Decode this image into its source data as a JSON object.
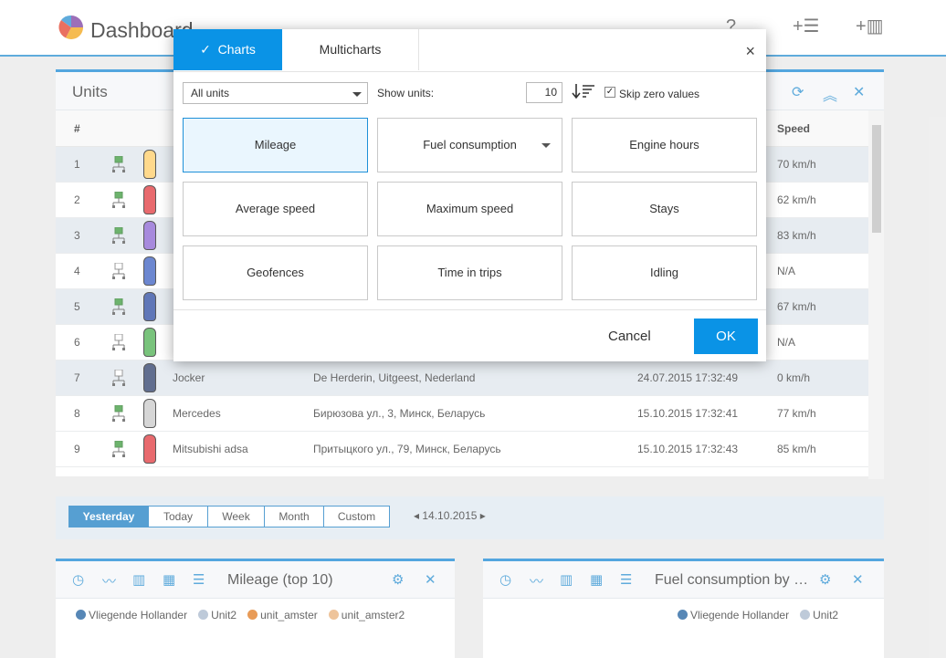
{
  "app": {
    "title": "Dashboard"
  },
  "units": {
    "title": "Units",
    "columns": {
      "num": "#",
      "speed": "Speed"
    },
    "rows": [
      {
        "num": "1",
        "name": "",
        "address": "",
        "time": "",
        "speed": "70 km/h",
        "online": true,
        "alt": true,
        "color": "#ffcc66"
      },
      {
        "num": "2",
        "name": "",
        "address": "",
        "time": "",
        "speed": "62 km/h",
        "online": true,
        "alt": false,
        "color": "#e0393e"
      },
      {
        "num": "3",
        "name": "",
        "address": "",
        "time": "",
        "speed": "83 km/h",
        "online": true,
        "alt": true,
        "color": "#8a63d2"
      },
      {
        "num": "4",
        "name": "",
        "address": "",
        "time": "",
        "speed": "N/A",
        "online": false,
        "alt": false,
        "color": "#3b5fc0"
      },
      {
        "num": "5",
        "name": "",
        "address": "",
        "time": "",
        "speed": "67 km/h",
        "online": true,
        "alt": true,
        "color": "#2b4aa0"
      },
      {
        "num": "6",
        "name": "",
        "address": "",
        "time": "",
        "speed": "N/A",
        "online": false,
        "alt": false,
        "color": "#4caf50"
      },
      {
        "num": "7",
        "name": "Jocker",
        "address": "De Herderin, Uitgeest, Nederland",
        "time": "24.07.2015 17:32:49",
        "speed": "0 km/h",
        "online": false,
        "alt": true,
        "color": "#2c3e6a"
      },
      {
        "num": "8",
        "name": "Mercedes",
        "address": "Бирюзова ул., 3, Минск, Беларусь",
        "time": "15.10.2015 17:32:41",
        "speed": "77 km/h",
        "online": true,
        "alt": false,
        "color": "#c8c8c8"
      },
      {
        "num": "9",
        "name": "Mitsubishi adsa",
        "address": "Притыцкого ул., 79, Минск, Беларусь",
        "time": "15.10.2015 17:32:43",
        "speed": "85 km/h",
        "online": true,
        "alt": false,
        "color": "#e0393e"
      }
    ]
  },
  "period": {
    "buttons": [
      "Yesterday",
      "Today",
      "Week",
      "Month",
      "Custom"
    ],
    "active": "Yesterday",
    "date": "14.10.2015"
  },
  "charts": {
    "left": {
      "title": "Mileage (top 10)",
      "legend": [
        {
          "name": "Vliegende Hollander",
          "color": "#1f5f9e"
        },
        {
          "name": "Unit2",
          "color": "#a9b8cc"
        },
        {
          "name": "unit_amster",
          "color": "#e07a1f"
        },
        {
          "name": "unit_amster2",
          "color": "#e8b07a"
        }
      ]
    },
    "right": {
      "title": "Fuel consumption by …",
      "legend": [
        {
          "name": "Vliegende Hollander",
          "color": "#1f5f9e"
        },
        {
          "name": "Unit2",
          "color": "#a9b8cc"
        }
      ]
    }
  },
  "modal": {
    "tabs": {
      "charts": "Charts",
      "multicharts": "Multicharts"
    },
    "close": "×",
    "units_select": "All units",
    "show_units_label": "Show units:",
    "show_units_value": "10",
    "skip_zero_label": "Skip zero values",
    "skip_zero_checked": true,
    "tiles": [
      {
        "label": "Mileage",
        "selected": true,
        "dropdown": false
      },
      {
        "label": "Fuel consumption",
        "selected": false,
        "dropdown": true
      },
      {
        "label": "Engine hours",
        "selected": false,
        "dropdown": false
      },
      {
        "label": "Average speed",
        "selected": false,
        "dropdown": false
      },
      {
        "label": "Maximum speed",
        "selected": false,
        "dropdown": false
      },
      {
        "label": "Stays",
        "selected": false,
        "dropdown": false
      },
      {
        "label": "Geofences",
        "selected": false,
        "dropdown": false
      },
      {
        "label": "Time in trips",
        "selected": false,
        "dropdown": false
      },
      {
        "label": "Idling",
        "selected": false,
        "dropdown": false
      }
    ],
    "cancel": "Cancel",
    "ok": "OK"
  }
}
